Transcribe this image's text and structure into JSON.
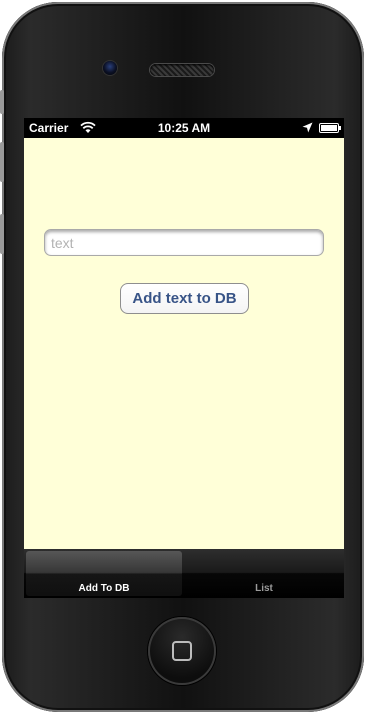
{
  "status_bar": {
    "carrier": "Carrier",
    "time": "10:25 AM"
  },
  "form": {
    "text_field_placeholder": "text",
    "text_field_value": "",
    "add_button_label": "Add text to DB"
  },
  "tab_bar": {
    "tabs": [
      {
        "label": "Add To DB",
        "selected": true
      },
      {
        "label": "List",
        "selected": false
      }
    ]
  },
  "colors": {
    "screen_background": "#ffffd8",
    "button_text": "#385487"
  },
  "icons": {
    "status": [
      "wifi-icon",
      "location-arrow-icon",
      "battery-icon"
    ],
    "home": "home-button-icon"
  }
}
